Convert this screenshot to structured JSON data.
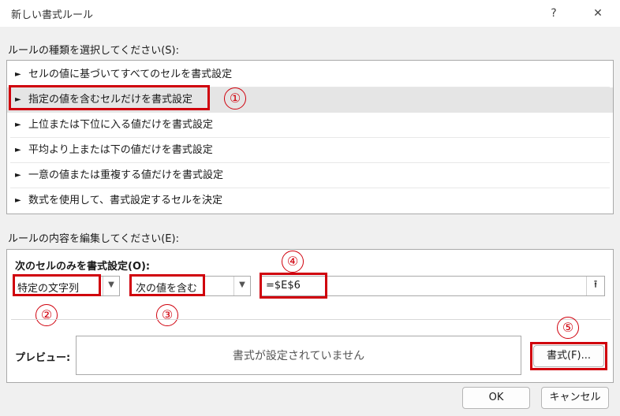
{
  "window": {
    "title": "新しい書式ルール",
    "help": "?",
    "close": "✕"
  },
  "rule_type": {
    "label": "ルールの種類を選択してください(S):",
    "items": [
      "セルの値に基づいてすべてのセルを書式設定",
      "指定の値を含むセルだけを書式設定",
      "上位または下位に入る値だけを書式設定",
      "平均より上または下の値だけを書式設定",
      "一意の値または重複する値だけを書式設定",
      "数式を使用して、書式設定するセルを決定"
    ],
    "selected_index": 1,
    "arrow": "►"
  },
  "edit": {
    "label": "ルールの内容を編集してください(E):",
    "heading": "次のセルのみを書式設定(O):",
    "combo1": "特定の文字列",
    "combo2": "次の値を含む",
    "value": "=$E$6",
    "collapse_icon": "⭱",
    "preview_label": "プレビュー:",
    "preview_text": "書式が設定されていません",
    "format_button": "書式(F)..."
  },
  "buttons": {
    "ok": "OK",
    "cancel": "キャンセル"
  },
  "annotations": [
    "①",
    "②",
    "③",
    "④",
    "⑤"
  ],
  "colors": {
    "highlight": "#d0000c",
    "selected_row": "#e5e5e5"
  }
}
